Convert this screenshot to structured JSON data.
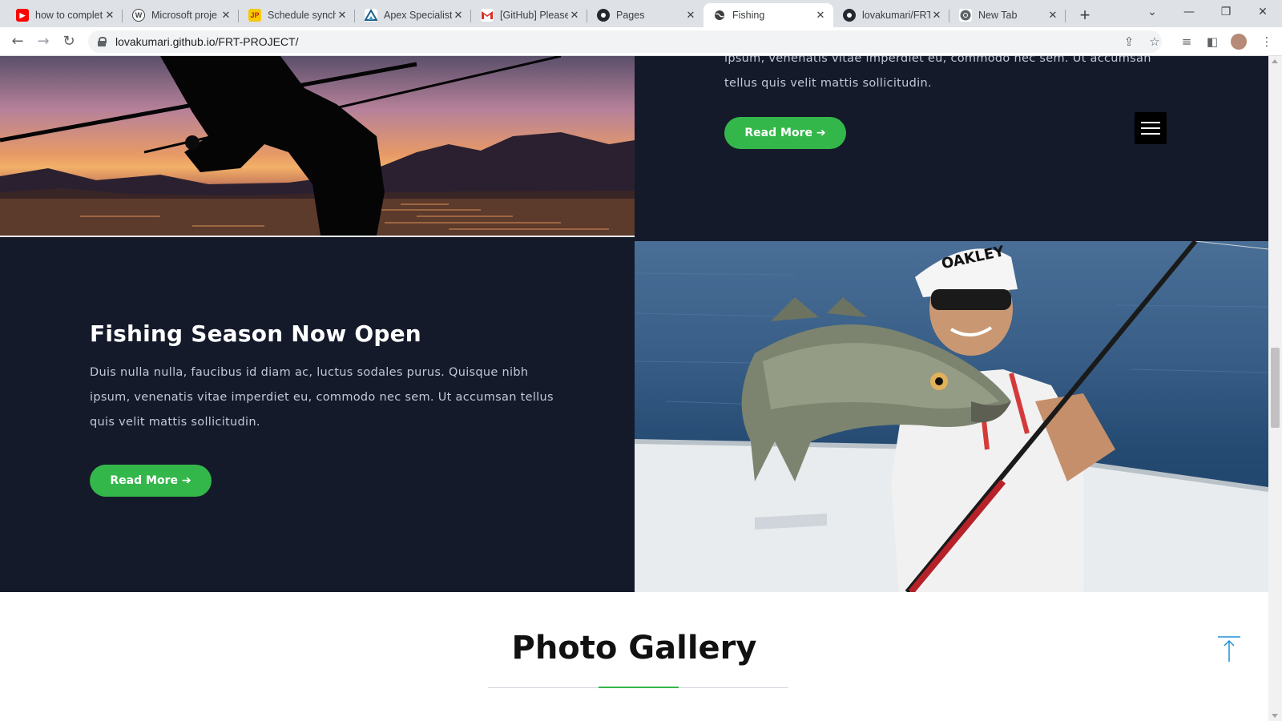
{
  "browser": {
    "tabs": [
      {
        "label": "how to complet",
        "favicon": "youtube-icon",
        "active": false
      },
      {
        "label": "Microsoft proje",
        "favicon": "wordpress-icon",
        "active": false
      },
      {
        "label": "Schedule synch",
        "favicon": "jp-icon",
        "active": false
      },
      {
        "label": "Apex Specialist",
        "favicon": "trailhead-icon",
        "active": false
      },
      {
        "label": "[GitHub] Please",
        "favicon": "gmail-icon",
        "active": false
      },
      {
        "label": "Pages",
        "favicon": "github-icon",
        "active": false
      },
      {
        "label": "Fishing",
        "favicon": "globe-icon",
        "active": true
      },
      {
        "label": "lovakumari/FRT",
        "favicon": "github-icon",
        "active": false
      },
      {
        "label": "New Tab",
        "favicon": "chrome-icon",
        "active": false
      }
    ],
    "url": "lovakumari.github.io/FRT-PROJECT/"
  },
  "page": {
    "top_section": {
      "body": "ipsum, venenatis vitae imperdiet eu, commodo nec sem. Ut accumsan tellus quis velit mattis sollicitudin.",
      "button": "Read More ➔"
    },
    "season_section": {
      "title": "Fishing Season Now Open",
      "body": "Duis nulla nulla, faucibus id diam ac, luctus sodales purus. Quisque nibh ipsum, venenatis vitae imperdiet eu, commodo nec sem. Ut accumsan tellus quis velit mattis sollicitudin.",
      "button": "Read More ➔"
    },
    "gallery": {
      "title": "Photo Gallery"
    },
    "cap_brand": "OAKLEY"
  },
  "colors": {
    "dark_bg": "#141a2a",
    "accent_green": "#34b74a",
    "back_to_top_blue": "#1e90d6"
  }
}
